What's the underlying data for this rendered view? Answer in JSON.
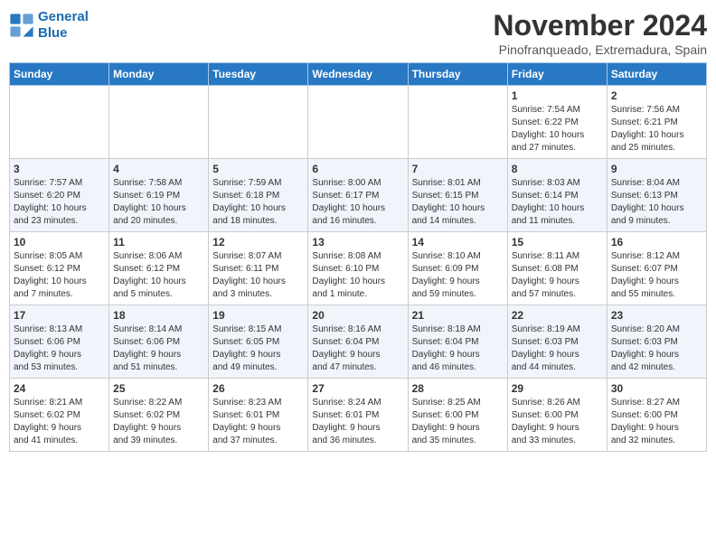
{
  "header": {
    "logo_line1": "General",
    "logo_line2": "Blue",
    "month": "November 2024",
    "location": "Pinofranqueado, Extremadura, Spain"
  },
  "weekdays": [
    "Sunday",
    "Monday",
    "Tuesday",
    "Wednesday",
    "Thursday",
    "Friday",
    "Saturday"
  ],
  "weeks": [
    [
      {
        "day": "",
        "info": ""
      },
      {
        "day": "",
        "info": ""
      },
      {
        "day": "",
        "info": ""
      },
      {
        "day": "",
        "info": ""
      },
      {
        "day": "",
        "info": ""
      },
      {
        "day": "1",
        "info": "Sunrise: 7:54 AM\nSunset: 6:22 PM\nDaylight: 10 hours\nand 27 minutes."
      },
      {
        "day": "2",
        "info": "Sunrise: 7:56 AM\nSunset: 6:21 PM\nDaylight: 10 hours\nand 25 minutes."
      }
    ],
    [
      {
        "day": "3",
        "info": "Sunrise: 7:57 AM\nSunset: 6:20 PM\nDaylight: 10 hours\nand 23 minutes."
      },
      {
        "day": "4",
        "info": "Sunrise: 7:58 AM\nSunset: 6:19 PM\nDaylight: 10 hours\nand 20 minutes."
      },
      {
        "day": "5",
        "info": "Sunrise: 7:59 AM\nSunset: 6:18 PM\nDaylight: 10 hours\nand 18 minutes."
      },
      {
        "day": "6",
        "info": "Sunrise: 8:00 AM\nSunset: 6:17 PM\nDaylight: 10 hours\nand 16 minutes."
      },
      {
        "day": "7",
        "info": "Sunrise: 8:01 AM\nSunset: 6:15 PM\nDaylight: 10 hours\nand 14 minutes."
      },
      {
        "day": "8",
        "info": "Sunrise: 8:03 AM\nSunset: 6:14 PM\nDaylight: 10 hours\nand 11 minutes."
      },
      {
        "day": "9",
        "info": "Sunrise: 8:04 AM\nSunset: 6:13 PM\nDaylight: 10 hours\nand 9 minutes."
      }
    ],
    [
      {
        "day": "10",
        "info": "Sunrise: 8:05 AM\nSunset: 6:12 PM\nDaylight: 10 hours\nand 7 minutes."
      },
      {
        "day": "11",
        "info": "Sunrise: 8:06 AM\nSunset: 6:12 PM\nDaylight: 10 hours\nand 5 minutes."
      },
      {
        "day": "12",
        "info": "Sunrise: 8:07 AM\nSunset: 6:11 PM\nDaylight: 10 hours\nand 3 minutes."
      },
      {
        "day": "13",
        "info": "Sunrise: 8:08 AM\nSunset: 6:10 PM\nDaylight: 10 hours\nand 1 minute."
      },
      {
        "day": "14",
        "info": "Sunrise: 8:10 AM\nSunset: 6:09 PM\nDaylight: 9 hours\nand 59 minutes."
      },
      {
        "day": "15",
        "info": "Sunrise: 8:11 AM\nSunset: 6:08 PM\nDaylight: 9 hours\nand 57 minutes."
      },
      {
        "day": "16",
        "info": "Sunrise: 8:12 AM\nSunset: 6:07 PM\nDaylight: 9 hours\nand 55 minutes."
      }
    ],
    [
      {
        "day": "17",
        "info": "Sunrise: 8:13 AM\nSunset: 6:06 PM\nDaylight: 9 hours\nand 53 minutes."
      },
      {
        "day": "18",
        "info": "Sunrise: 8:14 AM\nSunset: 6:06 PM\nDaylight: 9 hours\nand 51 minutes."
      },
      {
        "day": "19",
        "info": "Sunrise: 8:15 AM\nSunset: 6:05 PM\nDaylight: 9 hours\nand 49 minutes."
      },
      {
        "day": "20",
        "info": "Sunrise: 8:16 AM\nSunset: 6:04 PM\nDaylight: 9 hours\nand 47 minutes."
      },
      {
        "day": "21",
        "info": "Sunrise: 8:18 AM\nSunset: 6:04 PM\nDaylight: 9 hours\nand 46 minutes."
      },
      {
        "day": "22",
        "info": "Sunrise: 8:19 AM\nSunset: 6:03 PM\nDaylight: 9 hours\nand 44 minutes."
      },
      {
        "day": "23",
        "info": "Sunrise: 8:20 AM\nSunset: 6:03 PM\nDaylight: 9 hours\nand 42 minutes."
      }
    ],
    [
      {
        "day": "24",
        "info": "Sunrise: 8:21 AM\nSunset: 6:02 PM\nDaylight: 9 hours\nand 41 minutes."
      },
      {
        "day": "25",
        "info": "Sunrise: 8:22 AM\nSunset: 6:02 PM\nDaylight: 9 hours\nand 39 minutes."
      },
      {
        "day": "26",
        "info": "Sunrise: 8:23 AM\nSunset: 6:01 PM\nDaylight: 9 hours\nand 37 minutes."
      },
      {
        "day": "27",
        "info": "Sunrise: 8:24 AM\nSunset: 6:01 PM\nDaylight: 9 hours\nand 36 minutes."
      },
      {
        "day": "28",
        "info": "Sunrise: 8:25 AM\nSunset: 6:00 PM\nDaylight: 9 hours\nand 35 minutes."
      },
      {
        "day": "29",
        "info": "Sunrise: 8:26 AM\nSunset: 6:00 PM\nDaylight: 9 hours\nand 33 minutes."
      },
      {
        "day": "30",
        "info": "Sunrise: 8:27 AM\nSunset: 6:00 PM\nDaylight: 9 hours\nand 32 minutes."
      }
    ]
  ]
}
